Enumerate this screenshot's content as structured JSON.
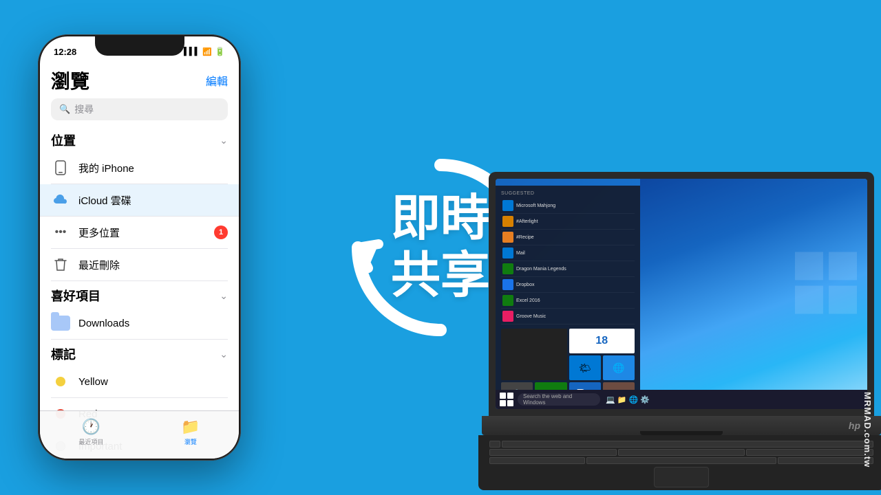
{
  "background": {
    "color": "#1a9fe0"
  },
  "center": {
    "line1": "即時",
    "line2": "共享"
  },
  "watermark": {
    "text": "MRMAD.com.tw"
  },
  "iphone": {
    "status_time": "12:28",
    "status_signal": "▌▌▌",
    "status_wifi": "WiFi",
    "status_battery": "Battery",
    "edit_label": "編輯",
    "title": "瀏覽",
    "search_placeholder": "搜尋",
    "sections": {
      "locations": {
        "title": "位置",
        "items": [
          {
            "icon": "phone-icon",
            "label": "我的 iPhone"
          },
          {
            "icon": "cloud-icon",
            "label": "iCloud 雲碟",
            "highlighted": true
          },
          {
            "icon": "more-icon",
            "label": "更多位置",
            "badge": "1"
          },
          {
            "icon": "trash-icon",
            "label": "最近刪除"
          }
        ]
      },
      "favorites": {
        "title": "喜好項目",
        "items": [
          {
            "icon": "folder-icon",
            "label": "Downloads"
          }
        ]
      },
      "tags": {
        "title": "標記",
        "items": [
          {
            "color": "#f4d03f",
            "label": "Yellow"
          },
          {
            "color": "#e74c3c",
            "label": "Red"
          },
          {
            "color": "#bbb",
            "label": "Important"
          }
        ]
      }
    },
    "tabs": [
      {
        "label": "最近項目",
        "active": false
      },
      {
        "label": "瀏覽",
        "active": true
      }
    ]
  },
  "laptop": {
    "hp_label": "hp",
    "taskbar": {
      "search_placeholder": "Search the web and Windows"
    },
    "start_menu": {
      "suggested_label": "Suggested",
      "apps": [
        {
          "name": "Microsoft Mahjong",
          "color": "#0078d4"
        },
        {
          "name": "#Recipe",
          "color": "#d68000"
        },
        {
          "name": "Mail",
          "color": "#0078d4"
        },
        {
          "name": "Dragon Mania Legends",
          "color": "#107c10"
        },
        {
          "name": "Dropbox",
          "color": "#1a73e8"
        },
        {
          "name": "Excel 2016",
          "color": "#107c10"
        },
        {
          "name": "Groove Music",
          "color": "#e91e63"
        }
      ],
      "tiles": [
        {
          "type": "photo",
          "color": ""
        },
        {
          "type": "calendar",
          "number": "18",
          "color": "white"
        },
        {
          "type": "blue",
          "emoji": "🔵"
        },
        {
          "type": "orange",
          "emoji": "🟠"
        },
        {
          "type": "teal",
          "emoji": "🧮"
        },
        {
          "type": "blue2",
          "emoji": "📧"
        },
        {
          "type": "weather",
          "color": "#555"
        },
        {
          "type": "blue3",
          "emoji": "📰"
        },
        {
          "type": "green",
          "emoji": "🟢"
        },
        {
          "type": "purple",
          "emoji": "🎮"
        },
        {
          "type": "dark",
          "emoji": "🖼️"
        },
        {
          "type": "red",
          "emoji": "🔴"
        },
        {
          "type": "orange2",
          "emoji": "📺"
        },
        {
          "type": "blue4",
          "emoji": "💬"
        },
        {
          "type": "gray",
          "emoji": "⚙️"
        },
        {
          "type": "green2",
          "emoji": "📊"
        }
      ]
    }
  }
}
